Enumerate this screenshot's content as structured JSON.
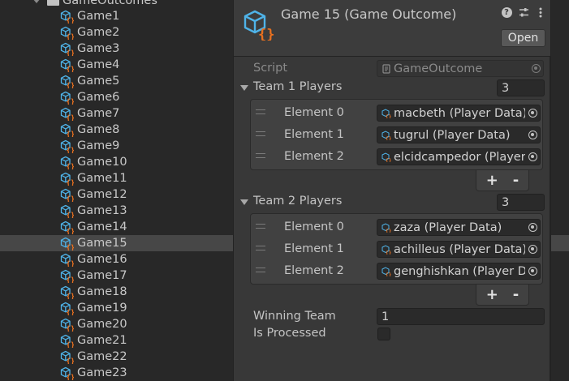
{
  "tree": {
    "folder_label": "GameOutcomes",
    "items": [
      "Game1",
      "Game2",
      "Game3",
      "Game4",
      "Game5",
      "Game6",
      "Game7",
      "Game8",
      "Game9",
      "Game10",
      "Game11",
      "Game12",
      "Game13",
      "Game14",
      "Game15",
      "Game16",
      "Game17",
      "Game18",
      "Game19",
      "Game20",
      "Game21",
      "Game22",
      "Game23"
    ],
    "selected": "Game15"
  },
  "inspector": {
    "title": "Game 15 (Game Outcome)",
    "open_label": "Open",
    "script_label": "Script",
    "script_value": "GameOutcome",
    "team1": {
      "label": "Team 1 Players",
      "size": "3",
      "elements": [
        {
          "label": "Element 0",
          "value": "macbeth (Player Data)"
        },
        {
          "label": "Element 1",
          "value": "tugrul (Player Data)"
        },
        {
          "label": "Element 2",
          "value": "elcidcampedor (Player Data)"
        }
      ]
    },
    "team2": {
      "label": "Team 2 Players",
      "size": "3",
      "elements": [
        {
          "label": "Element 0",
          "value": "zaza (Player Data)"
        },
        {
          "label": "Element 1",
          "value": "achilleus (Player Data)"
        },
        {
          "label": "Element 2",
          "value": "genghishkan (Player Data)"
        }
      ]
    },
    "add_label": "+",
    "remove_label": "-",
    "winning_team_label": "Winning Team",
    "winning_team_value": "1",
    "is_processed_label": "Is Processed",
    "is_processed_value": false
  },
  "colors": {
    "icon_blue": "#4fb3e8",
    "icon_orange": "#e8701f",
    "panel_bg": "#383838",
    "tree_bg": "#282828",
    "selection": "#474747"
  }
}
